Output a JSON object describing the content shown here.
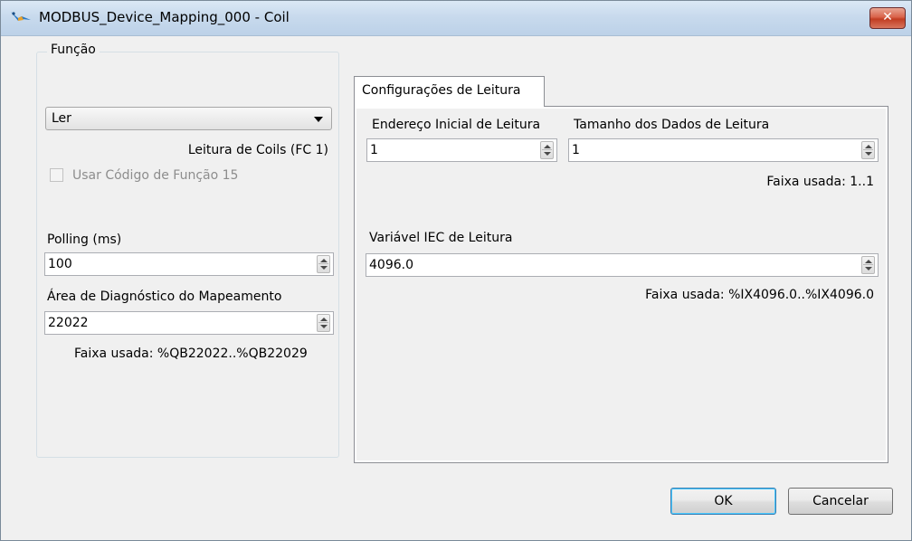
{
  "window": {
    "title": "MODBUS_Device_Mapping_000 - Coil",
    "close_glyph": "✕"
  },
  "funcao": {
    "legend": "Função",
    "selected": "Ler",
    "fc_label": "Leitura de Coils (FC 1)",
    "use_fc15_label": "Usar Código de Função 15",
    "use_fc15_checked": false,
    "use_fc15_enabled": false
  },
  "polling": {
    "label": "Polling (ms)",
    "value": "100"
  },
  "diagnostic": {
    "label": "Área de Diagnóstico do Mapeamento",
    "value": "22022",
    "range": "Faixa usada: %QB22022..%QB22029"
  },
  "tabs": [
    {
      "label": "Configurações de Leitura",
      "active": true
    }
  ],
  "read": {
    "start_address_label": "Endereço Inicial de Leitura",
    "start_address_value": "1",
    "data_size_label": "Tamanho dos Dados de Leitura",
    "data_size_value": "1",
    "data_size_range": "Faixa usada: 1..1",
    "iec_var_label": "Variável IEC de Leitura",
    "iec_var_value": "4096.0",
    "iec_var_range": "Faixa usada: %IX4096.0..%IX4096.0"
  },
  "buttons": {
    "ok": "OK",
    "cancel": "Cancelar"
  },
  "colors": {
    "titlebar": "#c8daed",
    "dialog_bg": "#f0f0f0",
    "close_button": "#c94a33",
    "ok_border": "#3c7fb1"
  },
  "icons": {
    "window": "modbus-device-icon",
    "close": "close-icon",
    "dropdown": "chevron-down-icon",
    "spin_up": "spin-up-icon",
    "spin_down": "spin-down-icon"
  }
}
